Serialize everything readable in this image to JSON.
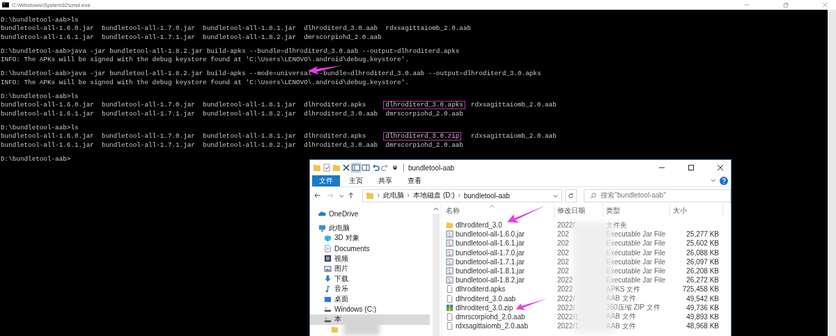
{
  "console": {
    "title": "C:\\Windows\\System32\\cmd.exe",
    "blocks": [
      [
        {
          "kind": "text",
          "text": "D:\\bundletool-aab>ls"
        },
        {
          "kind": "listing",
          "entries": [
            {
              "name": "bundletool-all-1.6.0.jar",
              "highlighted": false
            },
            {
              "name": "bundletool-all-1.7.0.jar",
              "highlighted": false
            },
            {
              "name": "bundletool-all-1.8.1.jar",
              "highlighted": false
            },
            {
              "name": "dlhroditerd_3.0.aab",
              "highlighted": false
            },
            {
              "name": "rdxsagittaiomb_2.0.aab",
              "highlighted": false
            }
          ]
        },
        {
          "kind": "listing",
          "entries": [
            {
              "name": "bundletool-all-1.6.1.jar",
              "highlighted": false
            },
            {
              "name": "bundletool-all-1.7.1.jar",
              "highlighted": false
            },
            {
              "name": "bundletool-all-1.8.2.jar",
              "highlighted": false
            },
            {
              "name": "dmrscorpiohd_2.0.aab",
              "highlighted": false
            }
          ]
        }
      ],
      [
        {
          "kind": "text",
          "text": "D:\\bundletool-aab>java -jar bundletool-all-1.8.2.jar build-apks --bundle=dlhroditerd_3.0.aab --output=dlhroditerd.apks"
        },
        {
          "kind": "text",
          "text": "INFO: The APKs will be signed with the debug keystore found at 'C:\\Users\\LENOVO\\.android\\debug.keystore'."
        }
      ],
      [
        {
          "kind": "text",
          "text": "D:\\bundletool-aab>java -jar bundletool-all-1.8.2.jar build-apks --mode=universal --bundle=dlhroditerd_3.0.aab --output=dlhroditerd_3.0.apks"
        },
        {
          "kind": "text",
          "text": "INFO: The APKs will be signed with the debug keystore found at 'C:\\Users\\LENOVO\\.android\\debug.keystore'."
        }
      ],
      [
        {
          "kind": "text",
          "text": "D:\\bundletool-aab>ls"
        },
        {
          "kind": "listing",
          "entries": [
            {
              "name": "bundletool-all-1.6.0.jar",
              "highlighted": false
            },
            {
              "name": "bundletool-all-1.7.0.jar",
              "highlighted": false
            },
            {
              "name": "bundletool-all-1.8.1.jar",
              "highlighted": false
            },
            {
              "name": "dlhroditerd.apks",
              "highlighted": false
            },
            {
              "name": "dlhroditerd_3.0.apks",
              "highlighted": true
            },
            {
              "name": "rdxsagittaiomb_2.0.aab",
              "highlighted": false
            }
          ]
        },
        {
          "kind": "listing",
          "entries": [
            {
              "name": "bundletool-all-1.6.1.jar",
              "highlighted": false
            },
            {
              "name": "bundletool-all-1.7.1.jar",
              "highlighted": false
            },
            {
              "name": "bundletool-all-1.8.2.jar",
              "highlighted": false
            },
            {
              "name": "dlhroditerd_3.0.aab",
              "highlighted": false
            },
            {
              "name": "dmrscorpiohd_2.0.aab",
              "highlighted": false
            }
          ]
        }
      ],
      [
        {
          "kind": "text",
          "text": "D:\\bundletool-aab>ls"
        },
        {
          "kind": "listing",
          "entries": [
            {
              "name": "bundletool-all-1.6.0.jar",
              "highlighted": false
            },
            {
              "name": "bundletool-all-1.7.0.jar",
              "highlighted": false
            },
            {
              "name": "bundletool-all-1.8.1.jar",
              "highlighted": false
            },
            {
              "name": "dlhroditerd.apks",
              "highlighted": false
            },
            {
              "name": "dlhroditerd_3.0.zip",
              "highlighted": true
            },
            {
              "name": "rdxsagittaiomb_2.0.aab",
              "highlighted": false
            }
          ]
        },
        {
          "kind": "listing",
          "entries": [
            {
              "name": "bundletool-all-1.6.1.jar",
              "highlighted": false
            },
            {
              "name": "bundletool-all-1.7.1.jar",
              "highlighted": false
            },
            {
              "name": "bundletool-all-1.8.2.jar",
              "highlighted": false
            },
            {
              "name": "dlhroditerd_3.0.aab",
              "highlighted": false
            },
            {
              "name": "dmrscorpiohd_2.0.aab",
              "highlighted": false
            }
          ]
        }
      ],
      [
        {
          "kind": "text",
          "text": "D:\\bundletool-aab>"
        }
      ]
    ]
  },
  "explorer": {
    "title": "bundletool-aab",
    "ribbon_tabs": [
      {
        "label": "文件",
        "selected": true
      },
      {
        "label": "主页",
        "selected": false
      },
      {
        "label": "共享",
        "selected": false
      },
      {
        "label": "查看",
        "selected": false
      }
    ],
    "breadcrumbs": [
      "此电脑",
      "本地磁盘 (D:)",
      "bundletool-aab"
    ],
    "search": {
      "placeholder": "搜索\"bundletool-aab\""
    },
    "nav": [
      {
        "label": "OneDrive",
        "kind": "cloud",
        "selected": false
      },
      {
        "label": "此电脑",
        "kind": "computer",
        "selected": false,
        "children": [
          {
            "label": "3D 对象",
            "kind": "cube",
            "selected": false
          },
          {
            "label": "Documents",
            "kind": "document",
            "selected": false
          },
          {
            "label": "视频",
            "kind": "video",
            "selected": false
          },
          {
            "label": "图片",
            "kind": "picture",
            "selected": false
          },
          {
            "label": "下载",
            "kind": "download",
            "selected": false
          },
          {
            "label": "音乐",
            "kind": "music",
            "selected": false
          },
          {
            "label": "桌面",
            "kind": "desktop",
            "selected": false
          },
          {
            "label": "Windows (C:)",
            "kind": "drive",
            "selected": false
          },
          {
            "label": "本",
            "kind": "drive",
            "selected": true,
            "children": [
              {
                "kind": "folder",
                "selected": false
              }
            ]
          }
        ]
      }
    ],
    "columns": [
      "名称",
      "修改日期",
      "类型",
      "大小"
    ],
    "files": [
      {
        "name": "dlhroditerd_3.0",
        "kind": "folder",
        "date": "2022/",
        "type": "文件夹"
      },
      {
        "name": "bundletool-all-1.6.0.jar",
        "kind": "jar",
        "date": "202",
        "type": "Executable Jar File",
        "size": "25,277 KB"
      },
      {
        "name": "bundletool-all-1.6.1.jar",
        "kind": "jar",
        "date": "202",
        "type": "Executable Jar File",
        "size": "25,602 KB"
      },
      {
        "name": "bundletool-all-1.7.0.jar",
        "kind": "jar",
        "date": "202",
        "type": "Executable Jar File",
        "size": "26,088 KB"
      },
      {
        "name": "bundletool-all-1.7.1.jar",
        "kind": "jar",
        "date": "202",
        "type": "Executable Jar File",
        "size": "26,097 KB"
      },
      {
        "name": "bundletool-all-1.8.1.jar",
        "kind": "jar",
        "date": "202",
        "type": "Executable Jar File",
        "size": "26,208 KB"
      },
      {
        "name": "bundletool-all-1.8.2.jar",
        "kind": "jar",
        "date": "2022",
        "type": "Executable Jar File",
        "size": "26,272 KB"
      },
      {
        "name": "dlhroditerd.apks",
        "kind": "file",
        "date": "2022",
        "type": "APKS 文件",
        "size": "725,458 KB"
      },
      {
        "name": "dlhroditerd_3.0.aab",
        "kind": "file",
        "date": "2022/",
        "type": "AAB 文件",
        "size": "49,542 KB"
      },
      {
        "name": "dlhroditerd_3.0.zip",
        "kind": "zip",
        "date": "2022/",
        "type": "360压缩 ZIP 文件",
        "size": "49,736 KB"
      },
      {
        "name": "dmrscorpiohd_2.0.aab",
        "kind": "file",
        "date": "2022/1",
        "type": "AAB 文件",
        "size": "49,893 KB"
      },
      {
        "name": "rdxsagittaiomb_2.0.aab",
        "kind": "file",
        "date": "2022/1",
        "type": "AAB 文件",
        "size": "48,968 KB"
      }
    ]
  }
}
